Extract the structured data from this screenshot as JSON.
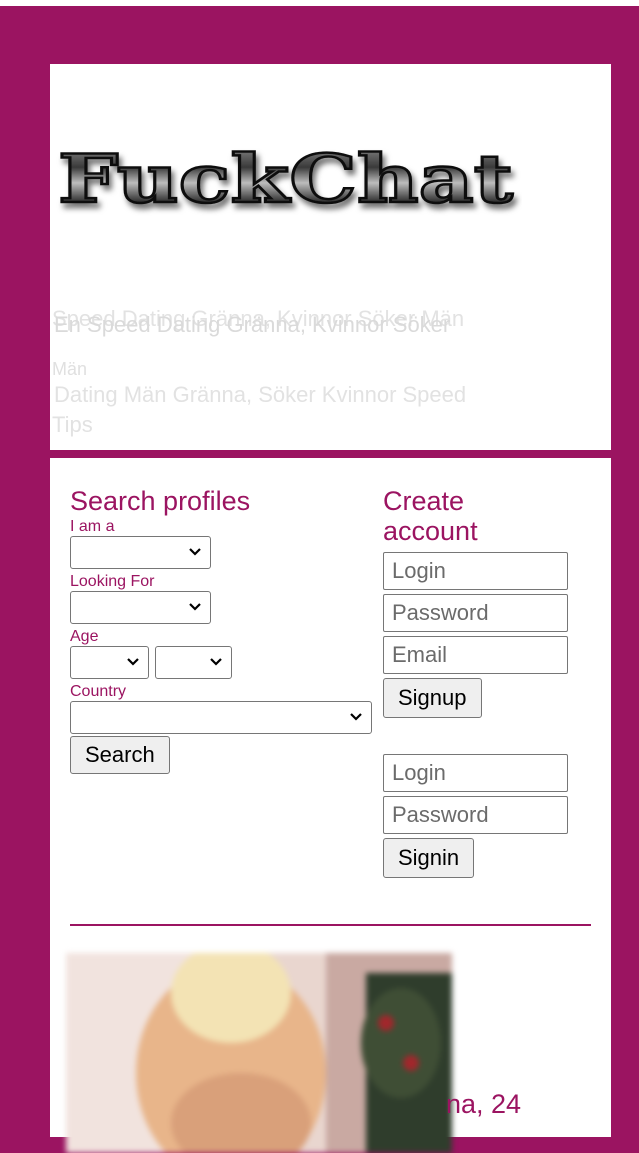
{
  "site": {
    "logo_text": "FuckChat",
    "taglines": [
      "Speed Dating Gränna, Kvinnor Söker Män",
      "En Speed Dating Gränna, Kvinnor Söker",
      "Män",
      "Dating Män Gränna, Söker Kvinnor Speed",
      "Tips"
    ]
  },
  "search": {
    "title": "Search profiles",
    "i_am_label": "I am a",
    "looking_for_label": "Looking For",
    "age_label": "Age",
    "country_label": "Country",
    "button": "Search"
  },
  "create": {
    "title_line1": "Create",
    "title_line2": "account",
    "login_placeholder": "Login",
    "password_placeholder": "Password",
    "email_placeholder": "Email",
    "signup_button": "Signup"
  },
  "signin": {
    "login_placeholder": "Login",
    "password_placeholder": "Password",
    "signin_button": "Signin"
  },
  "profile": {
    "name_partial": "na, 24"
  },
  "colors": {
    "brand": "#9b1461",
    "panel": "#ffffff"
  }
}
